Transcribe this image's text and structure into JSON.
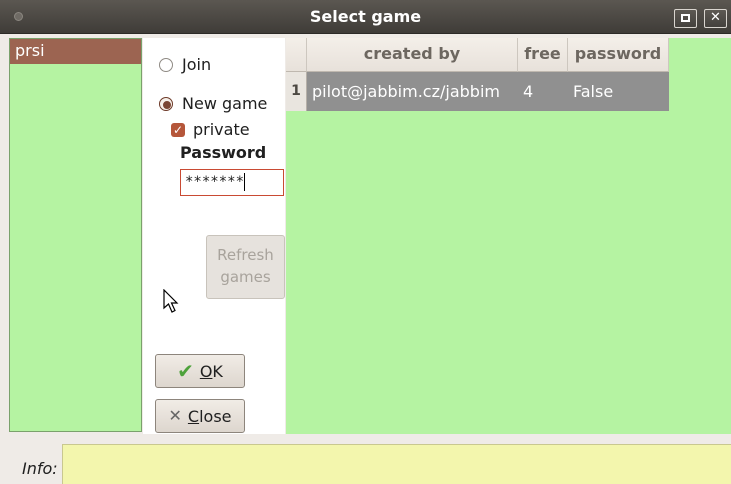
{
  "window": {
    "title": "Select game",
    "maximize_label": "",
    "close_label": "✕"
  },
  "game_list": {
    "items": [
      "prsi"
    ]
  },
  "options": {
    "join_label": "Join",
    "new_game_label": "New game",
    "private_label": "private",
    "private_checked": true,
    "password_label": "Password",
    "password_value": "*******",
    "refresh_line1": "Refresh",
    "refresh_line2": "games",
    "ok_prefix": "",
    "ok_mnemonic": "O",
    "ok_rest": "K",
    "close_mnemonic": "C",
    "close_rest": "lose"
  },
  "table": {
    "columns": [
      "created by",
      "free",
      "password"
    ],
    "rows": [
      {
        "num": "1",
        "created_by": "pilot@jabbim.cz/jabbim",
        "free": "4",
        "password": "False"
      }
    ]
  },
  "info": {
    "label": "Info:",
    "value": ""
  },
  "colors": {
    "list_bg": "#b5f3a2",
    "selected_item": "#9c6451",
    "info_bg": "#f3f6ad"
  }
}
